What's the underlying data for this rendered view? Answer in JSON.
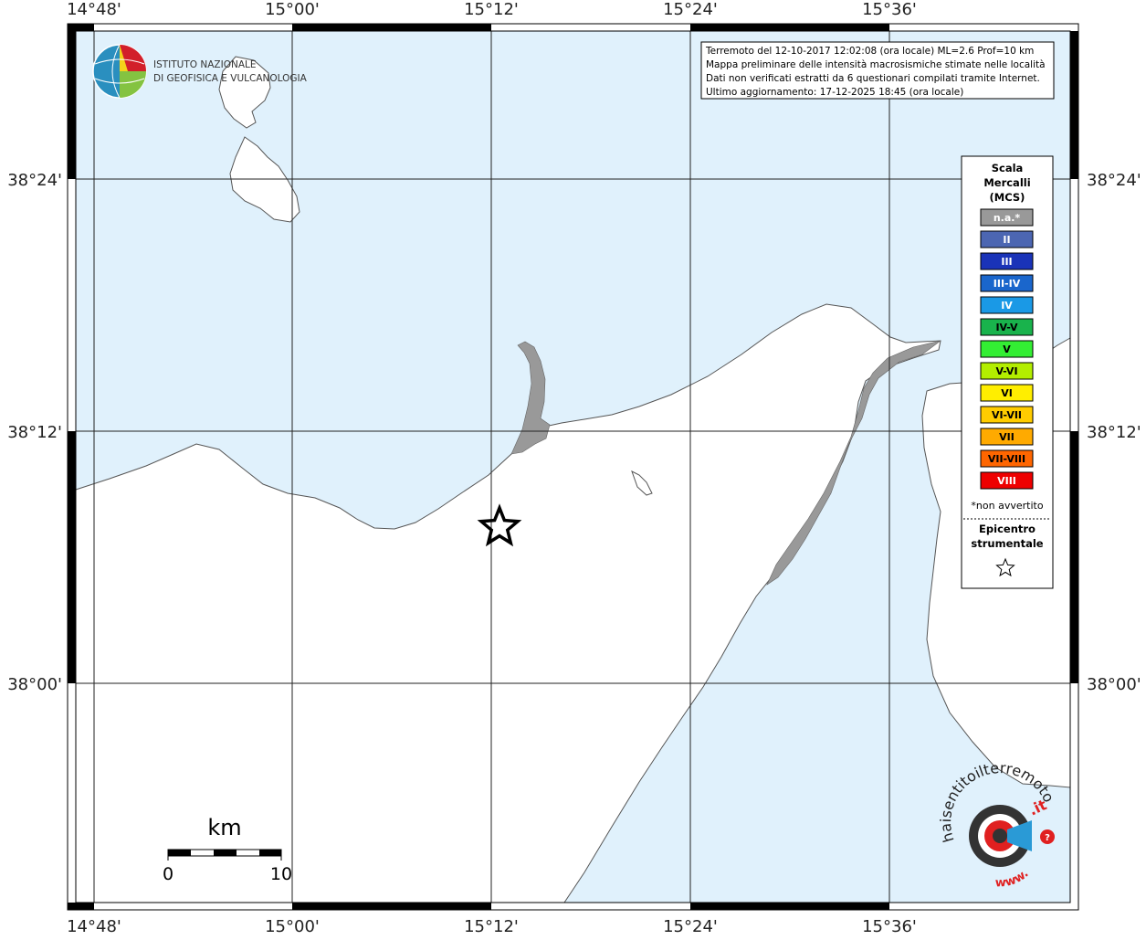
{
  "map": {
    "info_box": {
      "lines": [
        "Terremoto del 12-10-2017 12:02:08 (ora locale) ML=2.6 Prof=10 km",
        "Mappa preliminare delle intensità macrosismiche stimate nelle località",
        "Dati non verificati estratti da 6 questionari compilati tramite Internet.",
        "Ultimo aggiornamento: 17-12-2025 18:45 (ora locale)"
      ]
    },
    "x_ticks": [
      "14°48'",
      "15°00'",
      "15°12'",
      "15°24'",
      "15°36'"
    ],
    "y_ticks": [
      "38°24'",
      "38°12'",
      "38°00'"
    ],
    "org_logo": {
      "line1": "ISTITUTO NAZIONALE",
      "line2": "DI GEOFISICA E VULCANOLOGIA"
    },
    "scale_bar": {
      "unit": "km",
      "start": "0",
      "end": "10"
    },
    "site_logo": {
      "text": "haisentitoilterremoto",
      "suffix": ".it",
      "prefix": "www."
    },
    "colors": {
      "sea": "#e0f1fc",
      "land": "#ffffff",
      "lagoon": "#999999",
      "coast": "#555555"
    }
  },
  "legend": {
    "title": [
      "Scala",
      "Mercalli",
      "(MCS)"
    ],
    "items": [
      {
        "label": "n.a.*",
        "color": "#999999",
        "text": "#ffffff"
      },
      {
        "label": "II",
        "color": "#4c66b2",
        "text": "#ffffff"
      },
      {
        "label": "III",
        "color": "#1a33b8",
        "text": "#ffffff"
      },
      {
        "label": "III-IV",
        "color": "#1a66cc",
        "text": "#ffffff"
      },
      {
        "label": "IV",
        "color": "#1a99e6",
        "text": "#ffffff"
      },
      {
        "label": "IV-V",
        "color": "#19b34c",
        "text": "#000000"
      },
      {
        "label": "V",
        "color": "#33ee33",
        "text": "#000000"
      },
      {
        "label": "V-VI",
        "color": "#b3ee00",
        "text": "#000000"
      },
      {
        "label": "VI",
        "color": "#ffee00",
        "text": "#000000"
      },
      {
        "label": "VI-VII",
        "color": "#ffcc00",
        "text": "#000000"
      },
      {
        "label": "VII",
        "color": "#ffaa00",
        "text": "#000000"
      },
      {
        "label": "VII-VIII",
        "color": "#ff6600",
        "text": "#000000"
      },
      {
        "label": "VIII",
        "color": "#ee0000",
        "text": "#ffffff"
      }
    ],
    "note": "*non avvertito",
    "epicenter_label": [
      "Epicentro",
      "strumentale"
    ]
  }
}
